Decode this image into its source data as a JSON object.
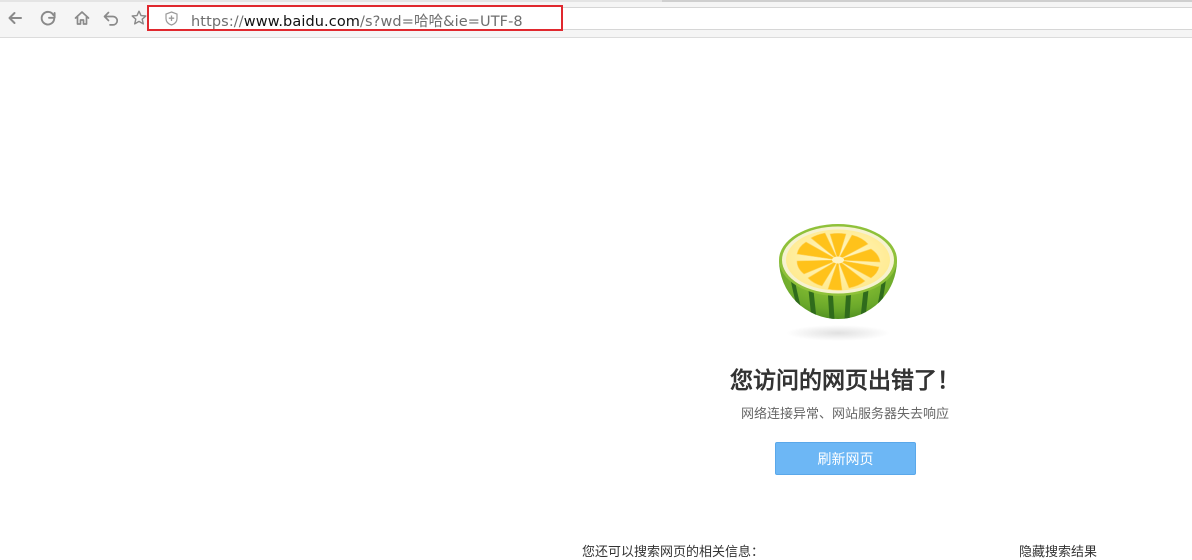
{
  "browser": {
    "url": {
      "prefix": "https://",
      "domain": "www.baidu.com",
      "path": "/s?wd=哈哈&ie=UTF-8"
    },
    "nav_icons": [
      "back-icon",
      "refresh-icon",
      "home-icon",
      "undo-icon",
      "favorite-star-icon"
    ],
    "highlight_color": "#e0282e"
  },
  "error_page": {
    "title": "您访问的网页出错了！",
    "subtitle": "网络连接异常、网站服务器失去响应",
    "refresh_button": "刷新网页",
    "search_hint": "您还可以搜索网页的相关信息：",
    "hide_results": "隐藏搜索结果",
    "button_color": "#6db7f5"
  }
}
